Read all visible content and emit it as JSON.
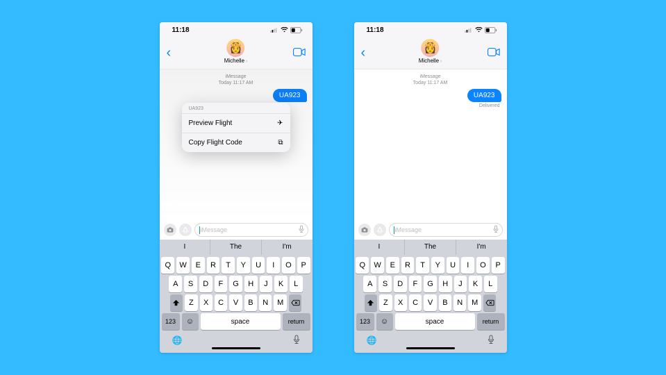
{
  "background_color": "#34baff",
  "accent_color": "#0a84ff",
  "statusbar": {
    "time": "11:18"
  },
  "header": {
    "contact_name": "Michelle"
  },
  "thread": {
    "service": "iMessage",
    "timestamp": "Today 11:17 AM",
    "message_text": "UA923",
    "delivered_label": "Delivered"
  },
  "context_menu": {
    "header": "UA923",
    "items": [
      {
        "label": "Preview Flight",
        "icon": "airplane-icon",
        "glyph": "✈"
      },
      {
        "label": "Copy Flight Code",
        "icon": "copy-icon",
        "glyph": "⧉"
      }
    ]
  },
  "input": {
    "placeholder": "iMessage"
  },
  "keyboard": {
    "suggestions": [
      "I",
      "The",
      "I'm"
    ],
    "row1": [
      "Q",
      "W",
      "E",
      "R",
      "T",
      "Y",
      "U",
      "I",
      "O",
      "P"
    ],
    "row2": [
      "A",
      "S",
      "D",
      "F",
      "G",
      "H",
      "J",
      "K",
      "L"
    ],
    "row3": [
      "Z",
      "X",
      "C",
      "V",
      "B",
      "N",
      "M"
    ],
    "key_123": "123",
    "key_space": "space",
    "key_return": "return"
  }
}
